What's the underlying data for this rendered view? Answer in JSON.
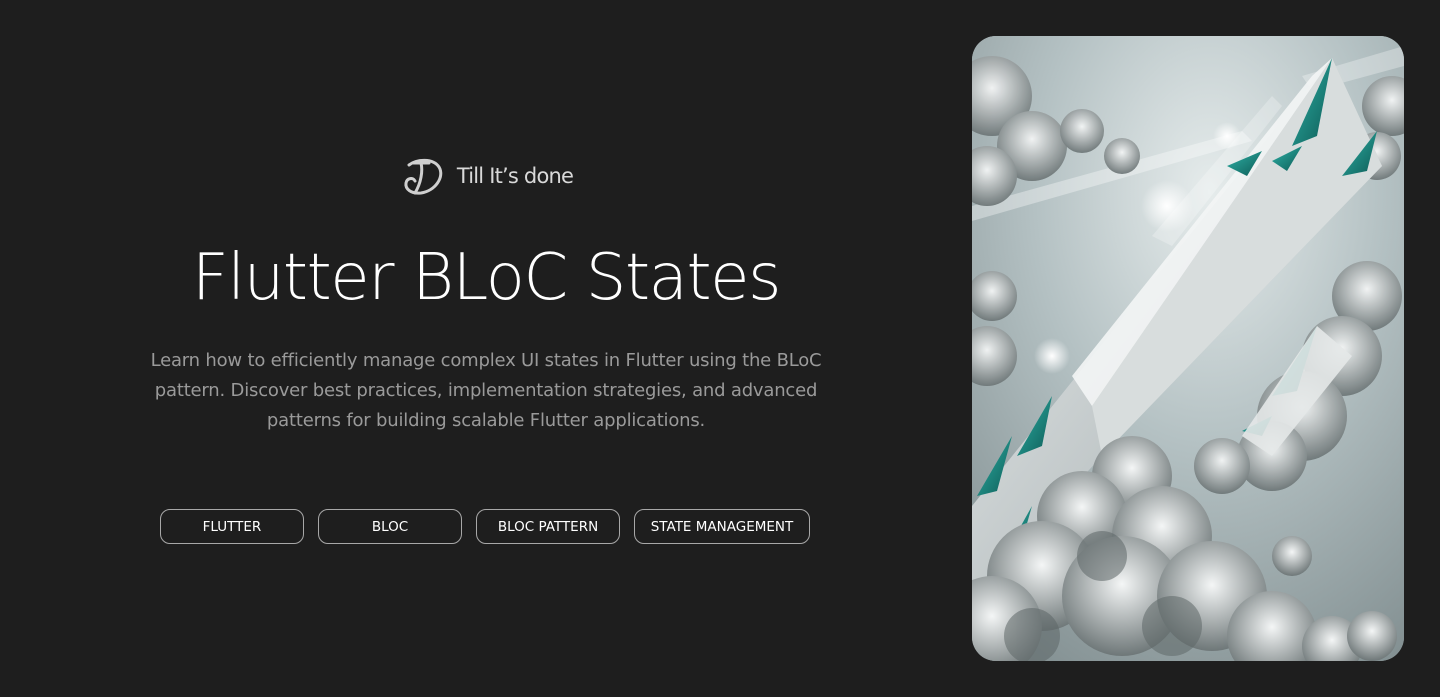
{
  "brand": {
    "logo_icon": "td-monogram-icon",
    "name": "Till It’s done"
  },
  "hero": {
    "title": "Flutter BLoC States",
    "description": "Learn how to efficiently manage complex UI states in Flutter using the BLoC pattern. Discover best practices, implementation strategies, and advanced patterns for building scalable Flutter applications.",
    "tags": [
      {
        "label": "FLUTTER"
      },
      {
        "label": "BLOC"
      },
      {
        "label": "BLOC PATTERN"
      },
      {
        "label": "STATE MANAGEMENT"
      }
    ]
  },
  "image": {
    "subject": "crystal-building-in-clouds-illustration"
  },
  "colors": {
    "background": "#1e1e1e",
    "title": "#ffffff",
    "description": "#9a9a9a",
    "tag_border": "#a8a8a8",
    "accent_teal": "#1f8f86"
  }
}
